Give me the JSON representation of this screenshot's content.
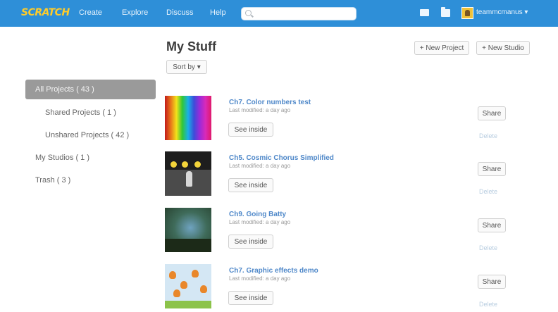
{
  "nav": {
    "logo": "SCRATCH",
    "create": "Create",
    "explore": "Explore",
    "discuss": "Discuss",
    "help": "Help",
    "search_placeholder": "",
    "username": "teammcmanus"
  },
  "header": {
    "title": "My Stuff",
    "sort_by": "Sort by",
    "new_project": "+ New Project",
    "new_studio": "+ New Studio"
  },
  "sidebar": {
    "items": [
      {
        "label": "All Projects ( 43 )",
        "active": true
      },
      {
        "label": "Shared Projects ( 1 )"
      },
      {
        "label": "Unshared Projects ( 42 )"
      },
      {
        "label": "My Studios ( 1 )"
      },
      {
        "label": "Trash ( 3 )"
      }
    ]
  },
  "projects": [
    {
      "title": "Ch7. Color numbers test",
      "meta": "Last modified: a day ago",
      "see_inside": "See inside",
      "share": "Share",
      "delete": "Delete",
      "thumbnail": "rainbow-stripes"
    },
    {
      "title": "Ch5. Cosmic Chorus Simplified",
      "meta": "Last modified: a day ago",
      "see_inside": "See inside",
      "share": "Share",
      "delete": "Delete",
      "thumbnail": "cosmic-chorus"
    },
    {
      "title": "Ch9. Going Batty",
      "meta": "Last modified: a day ago",
      "see_inside": "See inside",
      "share": "Share",
      "delete": "Delete",
      "thumbnail": "dark-forest"
    },
    {
      "title": "Ch7. Graphic effects demo",
      "meta": "Last modified: a day ago",
      "see_inside": "See inside",
      "share": "Share",
      "delete": "Delete",
      "thumbnail": "graphic-effects"
    }
  ],
  "colors": {
    "nav_bar": "#2e8fd8",
    "sidebar_active": "#9a9a9a",
    "link": "#4f88c9",
    "delete_link": "#b8cde0"
  }
}
